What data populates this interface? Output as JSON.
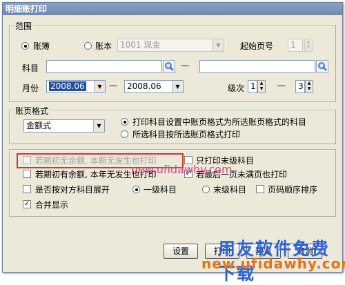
{
  "window": {
    "title": "明细账打印"
  },
  "range": {
    "group_label": "范围",
    "radio_ledger": "账簿",
    "radio_book": "账本",
    "book_value": "1001 现金",
    "start_page_label": "起始页号",
    "start_page_value": "1",
    "subject_label": "科目",
    "subject_from": "",
    "subject_to": "",
    "dash": "—",
    "month_label": "月份",
    "month_from": "2008.06",
    "month_to": "2008.06",
    "level_label": "级次",
    "level_from": "1",
    "level_to": "3"
  },
  "format": {
    "group_label": "账页格式",
    "format_value": "金额式",
    "option1": "打印科目设置中账页格式为所选账页格式的科目",
    "option2": "所选科目按所选账页格式打印"
  },
  "options": {
    "no_opening_balance": "若期初无余额, 本期无发生也打印",
    "only_leaf": "只打印末级科目",
    "has_opening_balance": "若期初有余额, 本年无发生也打印",
    "last_page_unfilled": "若最后一页未满页也打印",
    "expand_counter": "是否按对方科目展开",
    "first_level": "一级科目",
    "last_level": "末级科目",
    "page_order": "页码顺序排序",
    "merge_display": "合并显示"
  },
  "buttons": {
    "settings": "设置",
    "print": "打印",
    "preview": "预览",
    "cancel": "取消"
  },
  "watermark": {
    "line1": "用友软件免费下载",
    "line2": "new.ufidawhy.com",
    "line3": "new.ufidawhy.com"
  }
}
